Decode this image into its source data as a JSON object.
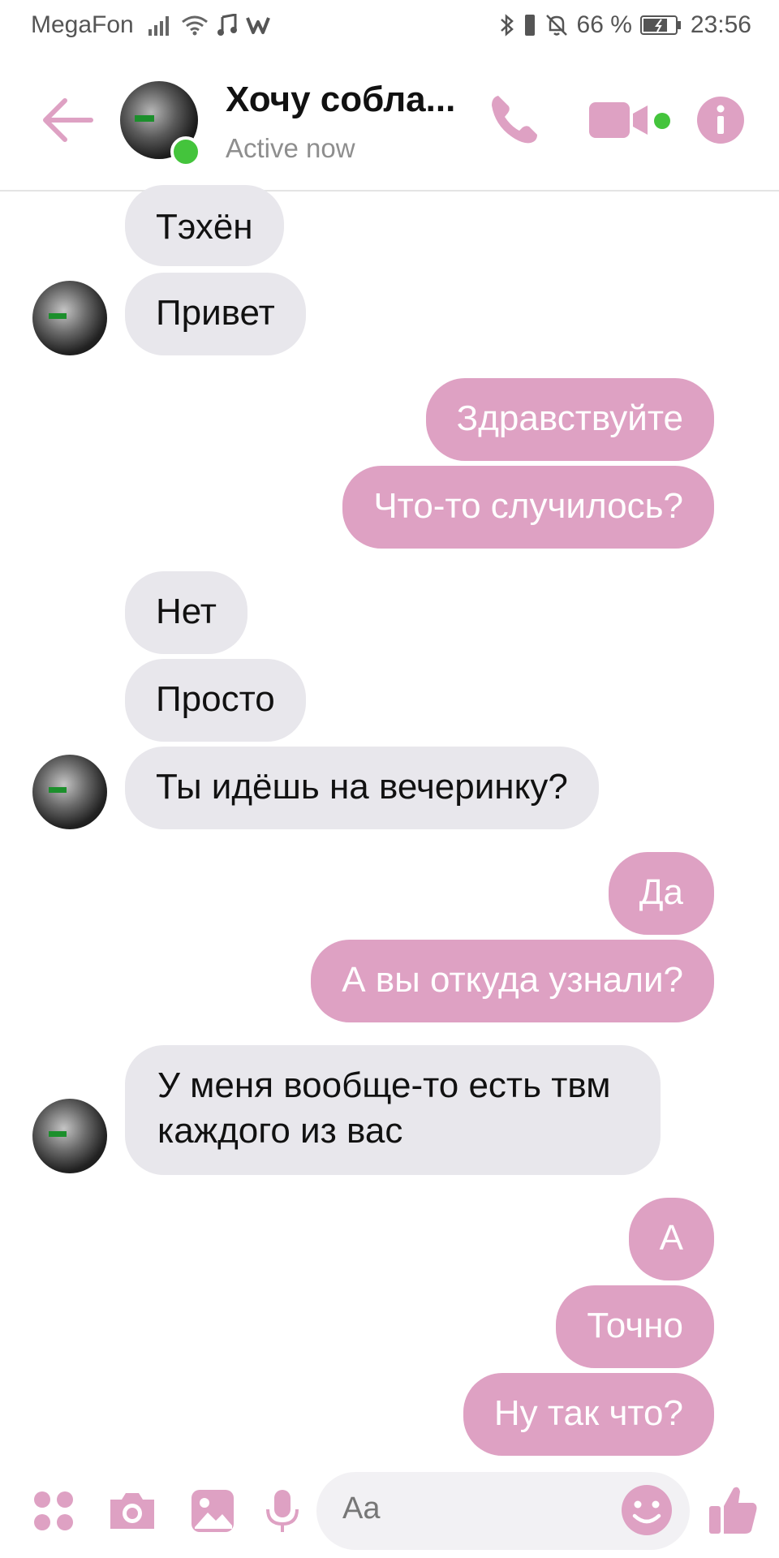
{
  "status_bar": {
    "carrier": "MegaFon",
    "battery_percent": "66 %",
    "time": "23:56",
    "icons": [
      "signal-icon",
      "wifi-icon",
      "music-icon",
      "w-icon",
      "bluetooth-icon",
      "vibrate-icon",
      "mute-bell-icon",
      "battery-icon"
    ]
  },
  "header": {
    "contact_name": "Хочу собла...",
    "status": "Active now",
    "icons": [
      "back-arrow-icon",
      "phone-icon",
      "video-camera-icon",
      "info-icon"
    ],
    "accent_color": "#dea1c3",
    "online_color": "#44c43c"
  },
  "messages": [
    {
      "side": "in",
      "text": "Тэхён"
    },
    {
      "side": "in",
      "text": "Привет"
    },
    {
      "side": "out",
      "text": "Здравствуйте"
    },
    {
      "side": "out",
      "text": "Что-то случилось?"
    },
    {
      "side": "in",
      "text": "Нет"
    },
    {
      "side": "in",
      "text": "Просто"
    },
    {
      "side": "in",
      "text": "Ты идёшь на вечеринку?"
    },
    {
      "side": "out",
      "text": "Да"
    },
    {
      "side": "out",
      "text": "А вы откуда узнали?"
    },
    {
      "side": "in",
      "text": "У меня вообще-то есть твм каждого из вас"
    },
    {
      "side": "out",
      "text": "А"
    },
    {
      "side": "out",
      "text": "Точно"
    },
    {
      "side": "out",
      "text": "Ну так что?"
    }
  ],
  "composer": {
    "placeholder": "Aa",
    "icons": [
      "apps-grid-icon",
      "camera-icon",
      "gallery-icon",
      "microphone-icon",
      "emoji-icon",
      "thumbs-up-icon"
    ]
  },
  "colors": {
    "outgoing_bubble": "#dea1c3",
    "incoming_bubble": "#e8e7ec"
  }
}
